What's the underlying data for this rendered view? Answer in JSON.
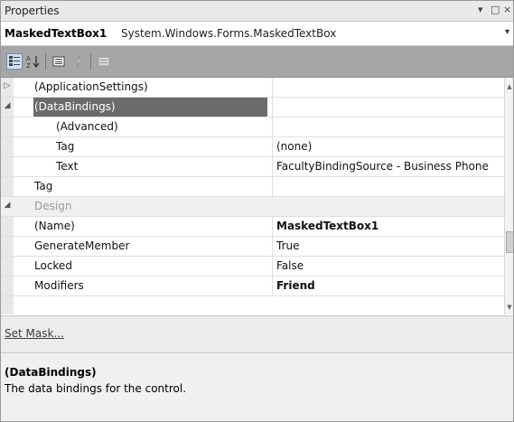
{
  "window": {
    "title": "Properties",
    "pin_glyph": "▾",
    "maximize_glyph": "□",
    "close_glyph": "×"
  },
  "object_selector": {
    "name": "MaskedTextBox1",
    "type": "System.Windows.Forms.MaskedTextBox",
    "dropdown_glyph": "▾"
  },
  "toolbar": {
    "categorized_icon": "categorized-icon",
    "alphabetical_icon": "alphabetical-icon",
    "properties_icon": "properties-icon",
    "events_icon": "events-icon",
    "property_pages_icon": "property-pages-icon"
  },
  "grid": {
    "rows": [
      {
        "name": "(ApplicationSettings)",
        "value": "",
        "expander": "▷",
        "indent": 0,
        "state": "normal"
      },
      {
        "name": "(DataBindings)",
        "value": "",
        "expander": "◢",
        "indent": 0,
        "state": "selected"
      },
      {
        "name": "(Advanced)",
        "value": "",
        "expander": "",
        "indent": 1,
        "state": "normal"
      },
      {
        "name": "Tag",
        "value": "(none)",
        "expander": "",
        "indent": 1,
        "state": "normal"
      },
      {
        "name": "Text",
        "value": "FacultyBindingSource - Business Phone",
        "expander": "",
        "indent": 1,
        "state": "normal"
      },
      {
        "name": "Tag",
        "value": "",
        "expander": "",
        "indent": 0,
        "state": "normal"
      },
      {
        "name": "Design",
        "value": "",
        "expander": "◢",
        "indent": 0,
        "state": "category"
      },
      {
        "name": "(Name)",
        "value": "MaskedTextBox1",
        "expander": "",
        "indent": 0,
        "state": "normal",
        "bold": true
      },
      {
        "name": "GenerateMember",
        "value": "True",
        "expander": "",
        "indent": 0,
        "state": "normal"
      },
      {
        "name": "Locked",
        "value": "False",
        "expander": "",
        "indent": 0,
        "state": "normal"
      },
      {
        "name": "Modifiers",
        "value": "Friend",
        "expander": "",
        "indent": 0,
        "state": "normal",
        "bold": true
      }
    ]
  },
  "commands": {
    "set_mask": "Set Mask..."
  },
  "description": {
    "title": "(DataBindings)",
    "text": "The data bindings for the control."
  }
}
